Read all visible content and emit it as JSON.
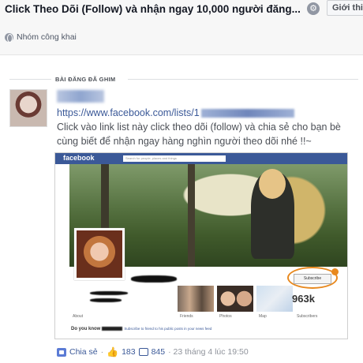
{
  "header": {
    "title": "Click Theo Dõi (Follow) và nhận ngay 10,000 người đăng...",
    "intro_button": "Giới thi",
    "group_privacy": "Nhóm công khai"
  },
  "post": {
    "pinned_label": "BÀI ĐĂNG ĐÃ GHIM",
    "link_prefix": "https://www.facebook.com/lists/",
    "link_suffix": "1",
    "text": "Click vào link list này click theo dõi (follow) và chia sẻ cho bạn bè cùng biết để nhận ngay hàng nghìn người theo dõi nhé !!~"
  },
  "screenshot": {
    "logo": "facebook",
    "search_placeholder": "Search for people, places and things",
    "subscribe_label": "Subscribe",
    "subscriber_count": "963k",
    "tabs": [
      "About",
      "Friends",
      "Photos",
      "Map",
      "Subscribers"
    ],
    "do_you_know": "Do you know",
    "do_you_know_rest": "Subscribe to friend to his public posts in your news feed"
  },
  "footer": {
    "share_label": "Chia sẻ",
    "separator": "·",
    "likes": "183",
    "comments": "845",
    "timestamp": "· 23 tháng 4 lúc 19:50"
  }
}
